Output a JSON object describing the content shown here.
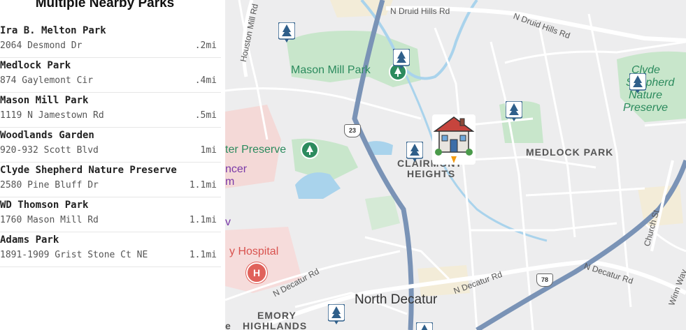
{
  "panel": {
    "title": "Multiple Nearby Parks",
    "parks": [
      {
        "name": "Ira B. Melton Park",
        "address": "2064 Desmond Dr",
        "distance": ".2mi"
      },
      {
        "name": "Medlock Park",
        "address": "874 Gaylemont Cir",
        "distance": ".4mi"
      },
      {
        "name": "Mason Mill Park",
        "address": "1119 N Jamestown Rd",
        "distance": ".5mi"
      },
      {
        "name": "Woodlands Garden",
        "address": "920-932 Scott Blvd",
        "distance": "1mi"
      },
      {
        "name": "Clyde Shepherd Nature Preserve",
        "address": "2580 Pine Bluff Dr",
        "distance": "1.1mi"
      },
      {
        "name": "WD Thomson Park",
        "address": "1760 Mason Mill Rd",
        "distance": "1.1mi"
      },
      {
        "name": "Adams Park",
        "address": "1891-1909 Grist Stone Ct NE",
        "distance": "1.1mi"
      }
    ]
  },
  "map": {
    "labels": {
      "mason_mill_park": "Mason Mill Park",
      "clyde_shepherd_1": "Clyde",
      "clyde_shepherd_2": "Shepherd",
      "clyde_shepherd_3": "Nature",
      "clyde_shepherd_4": "Preserve",
      "water_preserve": "ter Preserve",
      "cancer_1": "ncer",
      "cancer_2": "m",
      "medlock_park": "MEDLOCK PARK",
      "clairmont_1": "CLAIRMONT",
      "clairmont_2": "HEIGHTS",
      "emory_1": "EMORY",
      "emory_2": "HIGHLANDS",
      "north_decatur": "North Decatur",
      "hospital": "y Hospital",
      "hospital_letter": "H",
      "edge_v": "v",
      "edge_e": "e"
    },
    "roads": {
      "n_druid_hills": "N Druid Hills Rd",
      "n_druid_hills_2": "N Druid Hills Rd",
      "houston_mill": "Houston Mill Rd",
      "n_decatur_1": "N Decatur Rd",
      "n_decatur_2": "N Decatur Rd",
      "n_decatur_3": "N Decatur Rd",
      "church_st": "Church St",
      "winn_way": "Winn Way",
      "shield_23": "23",
      "shield_78": "78"
    },
    "colors": {
      "background": "#ededee",
      "park": "#c8e6cb",
      "water": "#a9d3ec",
      "major_road": "#7a93b6",
      "minor_road": "#ffffff",
      "park_text": "#2c8b5e",
      "hospital": "#d9534f",
      "tree_pin": "#2f5f8a"
    },
    "icons": [
      "tree-pin-icon",
      "home-marker-icon",
      "hospital-icon",
      "park-icon",
      "route-shield-icon"
    ]
  }
}
